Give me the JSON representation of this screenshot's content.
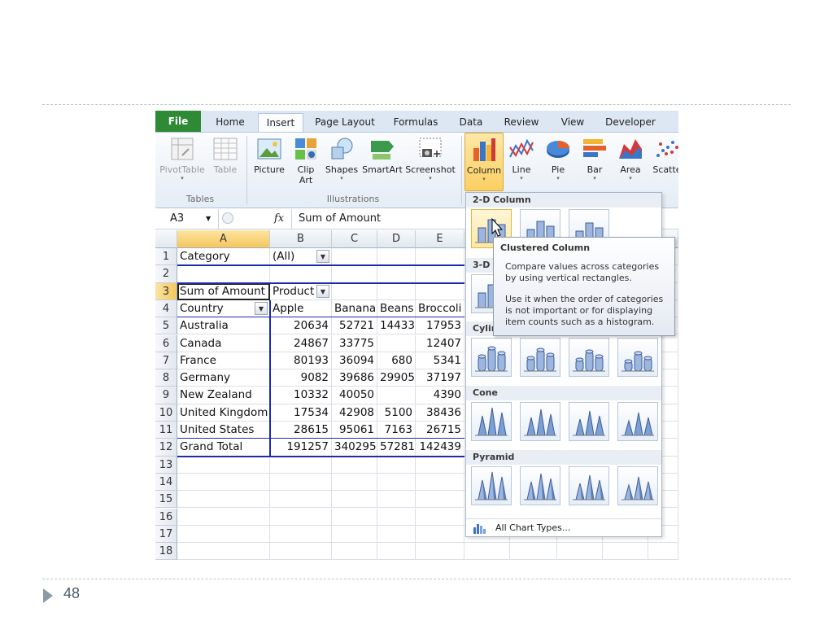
{
  "slide": {
    "page_number": "48"
  },
  "ribbon": {
    "tabs": [
      "File",
      "Home",
      "Insert",
      "Page Layout",
      "Formulas",
      "Data",
      "Review",
      "View",
      "Developer"
    ],
    "active_tab": "Insert",
    "groups": {
      "tables": "Tables",
      "illustrations": "Illustrations"
    },
    "buttons": {
      "pivottable": "PivotTable",
      "table": "Table",
      "picture": "Picture",
      "clipart_1": "Clip",
      "clipart_2": "Art",
      "shapes": "Shapes",
      "smartart": "SmartArt",
      "screenshot": "Screenshot",
      "column": "Column",
      "line": "Line",
      "pie": "Pie",
      "bar": "Bar",
      "area": "Area",
      "scatter": "Scatte"
    }
  },
  "formula_bar": {
    "name_box": "A3",
    "fx": "fx",
    "value": "Sum of Amount"
  },
  "sheet": {
    "columns": [
      "A",
      "B",
      "C",
      "D",
      "E"
    ],
    "rows": [
      "1",
      "2",
      "3",
      "4",
      "5",
      "6",
      "7",
      "8",
      "9",
      "10",
      "11",
      "12",
      "13",
      "14",
      "15",
      "16",
      "17",
      "18"
    ],
    "cells": {
      "r1": {
        "a": "Category",
        "b": "(All)"
      },
      "r3": {
        "a": "Sum of Amount",
        "b": "Product"
      },
      "r4": {
        "a": "Country",
        "b": "Apple",
        "c": "Banana",
        "d": "Beans",
        "e": "Broccoli"
      },
      "data": [
        {
          "a": "Australia",
          "b": "20634",
          "c": "52721",
          "d": "14433",
          "e": "17953"
        },
        {
          "a": "Canada",
          "b": "24867",
          "c": "33775",
          "d": "",
          "e": "12407"
        },
        {
          "a": "France",
          "b": "80193",
          "c": "36094",
          "d": "680",
          "e": "5341"
        },
        {
          "a": "Germany",
          "b": "9082",
          "c": "39686",
          "d": "29905",
          "e": "37197"
        },
        {
          "a": "New Zealand",
          "b": "10332",
          "c": "40050",
          "d": "",
          "e": "4390"
        },
        {
          "a": "United Kingdom",
          "b": "17534",
          "c": "42908",
          "d": "5100",
          "e": "38436"
        },
        {
          "a": "United States",
          "b": "28615",
          "c": "95061",
          "d": "7163",
          "e": "26715"
        },
        {
          "a": "Grand Total",
          "b": "191257",
          "c": "340295",
          "d": "57281",
          "e": "142439"
        }
      ]
    }
  },
  "gallery": {
    "sections": {
      "col2d": "2-D Column",
      "col3d": "3-D",
      "cylinder": "Cylin",
      "cone": "Cone",
      "pyramid": "Pyramid"
    },
    "all_chart_types": "All Chart Types...",
    "tooltip": {
      "title": "Clustered Column",
      "p1": "Compare values across categories by using vertical rectangles.",
      "p2": "Use it when the order of categories is not important or for displaying item counts such as a histogram."
    }
  }
}
